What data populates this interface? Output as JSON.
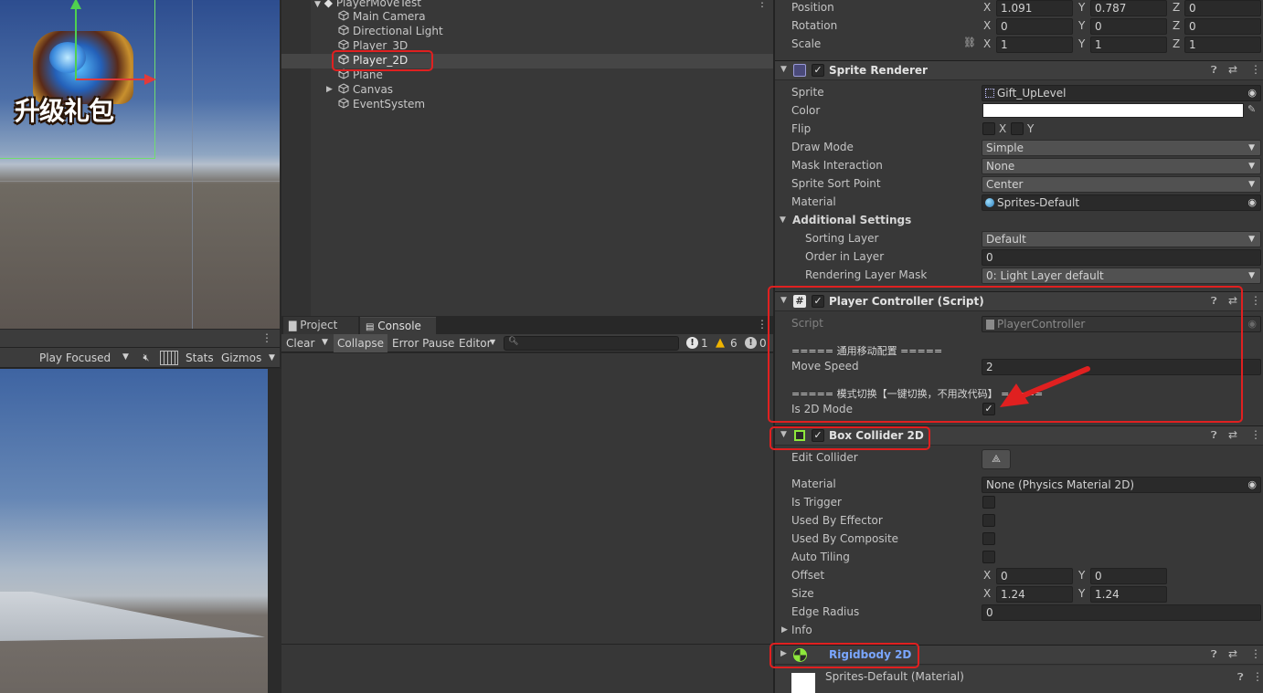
{
  "scene": {
    "logo_text": "升级礼包"
  },
  "game_toolbar": {
    "play_focused": "Play Focused",
    "stats": "Stats",
    "gizmos": "Gizmos"
  },
  "hierarchy": {
    "scene_name": "PlayerMoveTest",
    "items": [
      "Main Camera",
      "Directional Light",
      "Player_3D",
      "Player_2D",
      "Plane",
      "Canvas",
      "EventSystem"
    ]
  },
  "console": {
    "tabs": [
      "Project",
      "Console"
    ],
    "toolbar": {
      "clear": "Clear",
      "collapse": "Collapse",
      "error_pause": "Error Pause",
      "editor": "Editor"
    },
    "search_placeholder": "",
    "counts": {
      "errors": "1",
      "warnings": "6",
      "logs": "0"
    }
  },
  "inspector": {
    "transform": {
      "position_label": "Position",
      "rotation_label": "Rotation",
      "scale_label": "Scale",
      "position": {
        "x": "1.091",
        "y": "0.787",
        "z": "0"
      },
      "rotation": {
        "x": "0",
        "y": "0",
        "z": "0"
      },
      "scale": {
        "x": "1",
        "y": "1",
        "z": "1"
      }
    },
    "sprite_renderer": {
      "title": "Sprite Renderer",
      "sprite_label": "Sprite",
      "sprite": "Gift_UpLevel",
      "color_label": "Color",
      "flip_label": "Flip",
      "flip_x": "X",
      "flip_y": "Y",
      "draw_mode_label": "Draw Mode",
      "draw_mode": "Simple",
      "mask_label": "Mask Interaction",
      "mask": "None",
      "sort_point_label": "Sprite Sort Point",
      "sort_point": "Center",
      "material_label": "Material",
      "material": "Sprites-Default",
      "additional_label": "Additional Settings",
      "sorting_layer_label": "Sorting Layer",
      "sorting_layer": "Default",
      "order_label": "Order in Layer",
      "order": "0",
      "rendering_mask_label": "Rendering Layer Mask",
      "rendering_mask": "0: Light Layer default"
    },
    "player_controller": {
      "title": "Player Controller (Script)",
      "script_label": "Script",
      "script": "PlayerController",
      "header1": "===== 通用移动配置 =====",
      "move_speed_label": "Move Speed",
      "move_speed": "2",
      "header2": "===== 模式切换【一键切换，不用改代码】 =====",
      "is2d_label": "Is 2D Mode",
      "is2d": "✓"
    },
    "box_collider": {
      "title": "Box Collider 2D",
      "edit_label": "Edit Collider",
      "material_label": "Material",
      "material": "None (Physics Material 2D)",
      "is_trigger_label": "Is Trigger",
      "effector_label": "Used By Effector",
      "composite_label": "Used By Composite",
      "auto_tiling_label": "Auto Tiling",
      "offset_label": "Offset",
      "offset": {
        "x": "0",
        "y": "0"
      },
      "size_label": "Size",
      "size": {
        "x": "1.24",
        "y": "1.24"
      },
      "edge_label": "Edge Radius",
      "edge": "0",
      "info_label": "Info"
    },
    "rigidbody": {
      "title": "Rigidbody 2D"
    },
    "material_footer": {
      "title": "Sprites-Default (Material)"
    }
  },
  "colors": {
    "highlight": "#e02020",
    "rigidbody_title": "#7aa6ff",
    "background": "#282828"
  }
}
